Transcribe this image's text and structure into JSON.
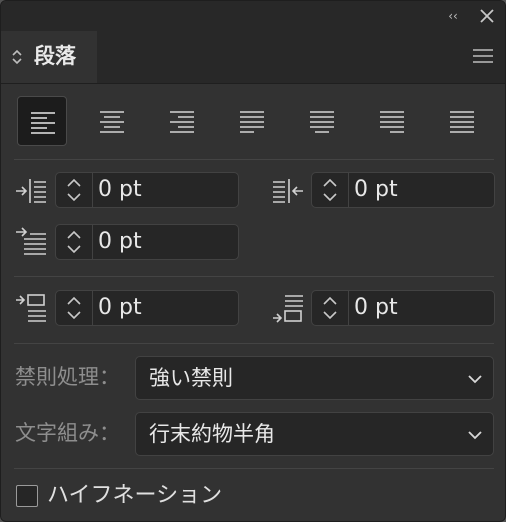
{
  "titlebar": {
    "collapse_glyph": "‹‹",
    "close_icon": "close-icon"
  },
  "tab": {
    "label": "段落",
    "arrows_icon": "updown-arrows-icon"
  },
  "menu_icon": "hamburger-menu-icon",
  "alignment_buttons": [
    {
      "name": "align-left",
      "active": true
    },
    {
      "name": "align-center",
      "active": false
    },
    {
      "name": "align-right",
      "active": false
    },
    {
      "name": "justify-last-left",
      "active": false
    },
    {
      "name": "justify-last-center",
      "active": false
    },
    {
      "name": "justify-last-right",
      "active": false
    },
    {
      "name": "justify-all",
      "active": false
    }
  ],
  "indents": {
    "left_indent": "0 pt",
    "right_indent": "0 pt",
    "first_line_indent": "0 pt",
    "space_before": "0 pt",
    "space_after": "0 pt"
  },
  "kinsoku": {
    "label": "禁則処理：",
    "value": "強い禁則"
  },
  "mojikumi": {
    "label": "文字組み：",
    "value": "行末約物半角"
  },
  "hyphenation": {
    "label": "ハイフネーション",
    "checked": false
  },
  "colors": {
    "panel": "#323232",
    "field": "#262626",
    "text": "#e8e8e8",
    "label": "#8e8e8e"
  }
}
